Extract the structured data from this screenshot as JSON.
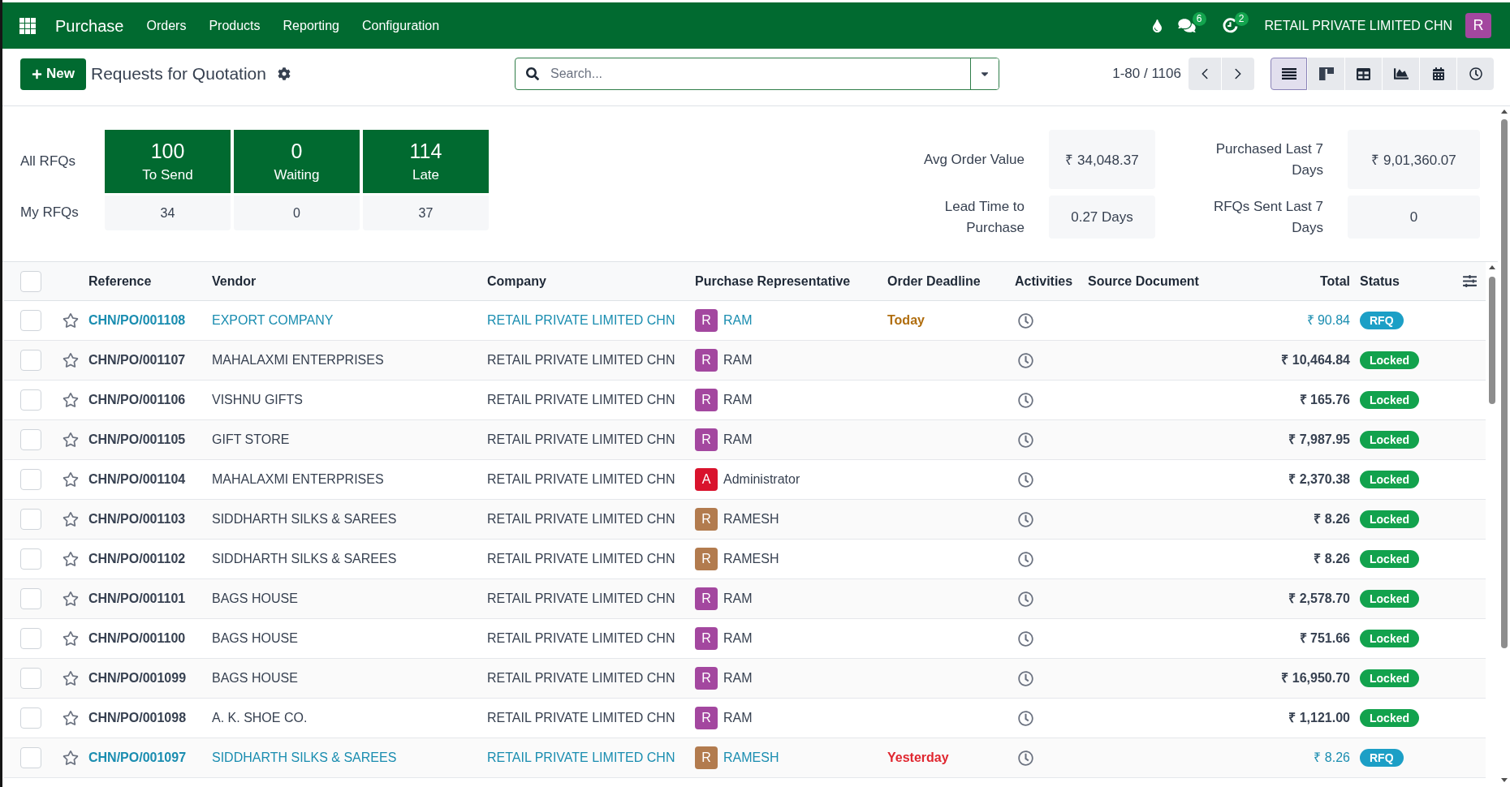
{
  "navbar": {
    "app_name": "Purchase",
    "menu": [
      "Orders",
      "Products",
      "Reporting",
      "Configuration"
    ],
    "systray": [
      {
        "kind": "drop"
      },
      {
        "kind": "chat",
        "count": "6"
      },
      {
        "kind": "activity",
        "count": "2"
      }
    ],
    "company": "RETAIL PRIVATE LIMITED CHN",
    "user_initial": "R"
  },
  "control_panel": {
    "new_button": "New",
    "title": "Requests for Quotation",
    "search": {
      "placeholder": "Search..."
    },
    "pager": "1-80 / 1106",
    "views": [
      {
        "kind": "list",
        "selected": true
      },
      {
        "kind": "kanban",
        "selected": false
      },
      {
        "kind": "pivot",
        "selected": false
      },
      {
        "kind": "graph",
        "selected": false
      },
      {
        "kind": "calendar",
        "selected": false
      },
      {
        "kind": "activity",
        "selected": false
      }
    ]
  },
  "dashboard": {
    "all_label": "All RFQs",
    "my_label": "My RFQs",
    "tiles": [
      {
        "count": "100",
        "label": "To Send",
        "mine": "34"
      },
      {
        "count": "0",
        "label": "Waiting",
        "mine": "0"
      },
      {
        "count": "114",
        "label": "Late",
        "mine": "37"
      }
    ],
    "stats": [
      {
        "label": "Avg Order Value",
        "value": "₹ 34,048.37"
      },
      {
        "label": "Purchased Last 7 Days",
        "value": "₹ 9,01,360.07"
      },
      {
        "label": "Lead Time to Purchase",
        "value": "0.27 Days"
      },
      {
        "label": "RFQs Sent Last 7 Days",
        "value": "0"
      }
    ]
  },
  "table": {
    "all_selected": false,
    "columns": [
      "Reference",
      "Vendor",
      "Company",
      "Purchase Representative",
      "Order Deadline",
      "Activities",
      "Source Document",
      "Total",
      "Status"
    ],
    "rows": [
      {
        "selected": false,
        "starred": false,
        "reference": "CHN/PO/001108",
        "vendor": "EXPORT COMPANY",
        "company": "RETAIL PRIVATE LIMITED CHN",
        "representative": {
          "initial": "R",
          "name": "RAM",
          "color": "#a3479f"
        },
        "deadline": {
          "text": "Today",
          "color": "#b06d0e"
        },
        "total": "₹ 90.84",
        "status": {
          "label": "RFQ",
          "kind": "draft"
        }
      },
      {
        "selected": false,
        "starred": false,
        "reference": "CHN/PO/001107",
        "vendor": "MAHALAXMI ENTERPRISES",
        "company": "RETAIL PRIVATE LIMITED CHN",
        "representative": {
          "initial": "R",
          "name": "RAM",
          "color": "#a3479f"
        },
        "total": "₹ 10,464.84",
        "status": {
          "label": "Locked",
          "kind": "locked"
        }
      },
      {
        "selected": false,
        "starred": false,
        "reference": "CHN/PO/001106",
        "vendor": "VISHNU GIFTS",
        "company": "RETAIL PRIVATE LIMITED CHN",
        "representative": {
          "initial": "R",
          "name": "RAM",
          "color": "#a3479f"
        },
        "total": "₹ 165.76",
        "status": {
          "label": "Locked",
          "kind": "locked"
        }
      },
      {
        "selected": false,
        "starred": false,
        "reference": "CHN/PO/001105",
        "vendor": "GIFT STORE",
        "company": "RETAIL PRIVATE LIMITED CHN",
        "representative": {
          "initial": "R",
          "name": "RAM",
          "color": "#a3479f"
        },
        "total": "₹ 7,987.95",
        "status": {
          "label": "Locked",
          "kind": "locked"
        }
      },
      {
        "selected": false,
        "starred": false,
        "reference": "CHN/PO/001104",
        "vendor": "MAHALAXMI ENTERPRISES",
        "company": "RETAIL PRIVATE LIMITED CHN",
        "representative": {
          "initial": "A",
          "name": "Administrator",
          "color": "#d9132d"
        },
        "total": "₹ 2,370.38",
        "status": {
          "label": "Locked",
          "kind": "locked"
        }
      },
      {
        "selected": false,
        "starred": false,
        "reference": "CHN/PO/001103",
        "vendor": "SIDDHARTH SILKS & SAREES",
        "company": "RETAIL PRIVATE LIMITED CHN",
        "representative": {
          "initial": "R",
          "name": "RAMESH",
          "color": "#b27b4e"
        },
        "total": "₹ 8.26",
        "status": {
          "label": "Locked",
          "kind": "locked"
        }
      },
      {
        "selected": false,
        "starred": false,
        "reference": "CHN/PO/001102",
        "vendor": "SIDDHARTH SILKS & SAREES",
        "company": "RETAIL PRIVATE LIMITED CHN",
        "representative": {
          "initial": "R",
          "name": "RAMESH",
          "color": "#b27b4e"
        },
        "total": "₹ 8.26",
        "status": {
          "label": "Locked",
          "kind": "locked"
        }
      },
      {
        "selected": false,
        "starred": false,
        "reference": "CHN/PO/001101",
        "vendor": "BAGS HOUSE",
        "company": "RETAIL PRIVATE LIMITED CHN",
        "representative": {
          "initial": "R",
          "name": "RAM",
          "color": "#a3479f"
        },
        "total": "₹ 2,578.70",
        "status": {
          "label": "Locked",
          "kind": "locked"
        }
      },
      {
        "selected": false,
        "starred": false,
        "reference": "CHN/PO/001100",
        "vendor": "BAGS HOUSE",
        "company": "RETAIL PRIVATE LIMITED CHN",
        "representative": {
          "initial": "R",
          "name": "RAM",
          "color": "#a3479f"
        },
        "total": "₹ 751.66",
        "status": {
          "label": "Locked",
          "kind": "locked"
        }
      },
      {
        "selected": false,
        "starred": false,
        "reference": "CHN/PO/001099",
        "vendor": "BAGS HOUSE",
        "company": "RETAIL PRIVATE LIMITED CHN",
        "representative": {
          "initial": "R",
          "name": "RAM",
          "color": "#a3479f"
        },
        "total": "₹ 16,950.70",
        "status": {
          "label": "Locked",
          "kind": "locked"
        }
      },
      {
        "selected": false,
        "starred": false,
        "reference": "CHN/PO/001098",
        "vendor": "A. K. SHOE CO.",
        "company": "RETAIL PRIVATE LIMITED CHN",
        "representative": {
          "initial": "R",
          "name": "RAM",
          "color": "#a3479f"
        },
        "total": "₹ 1,121.00",
        "status": {
          "label": "Locked",
          "kind": "locked"
        }
      },
      {
        "selected": false,
        "starred": false,
        "reference": "CHN/PO/001097",
        "vendor": "SIDDHARTH SILKS & SAREES",
        "company": "RETAIL PRIVATE LIMITED CHN",
        "representative": {
          "initial": "R",
          "name": "RAMESH",
          "color": "#b27b4e"
        },
        "deadline": {
          "text": "Yesterday",
          "color": "#e0262f"
        },
        "total": "₹ 8.26",
        "status": {
          "label": "RFQ",
          "kind": "draft"
        }
      }
    ]
  }
}
